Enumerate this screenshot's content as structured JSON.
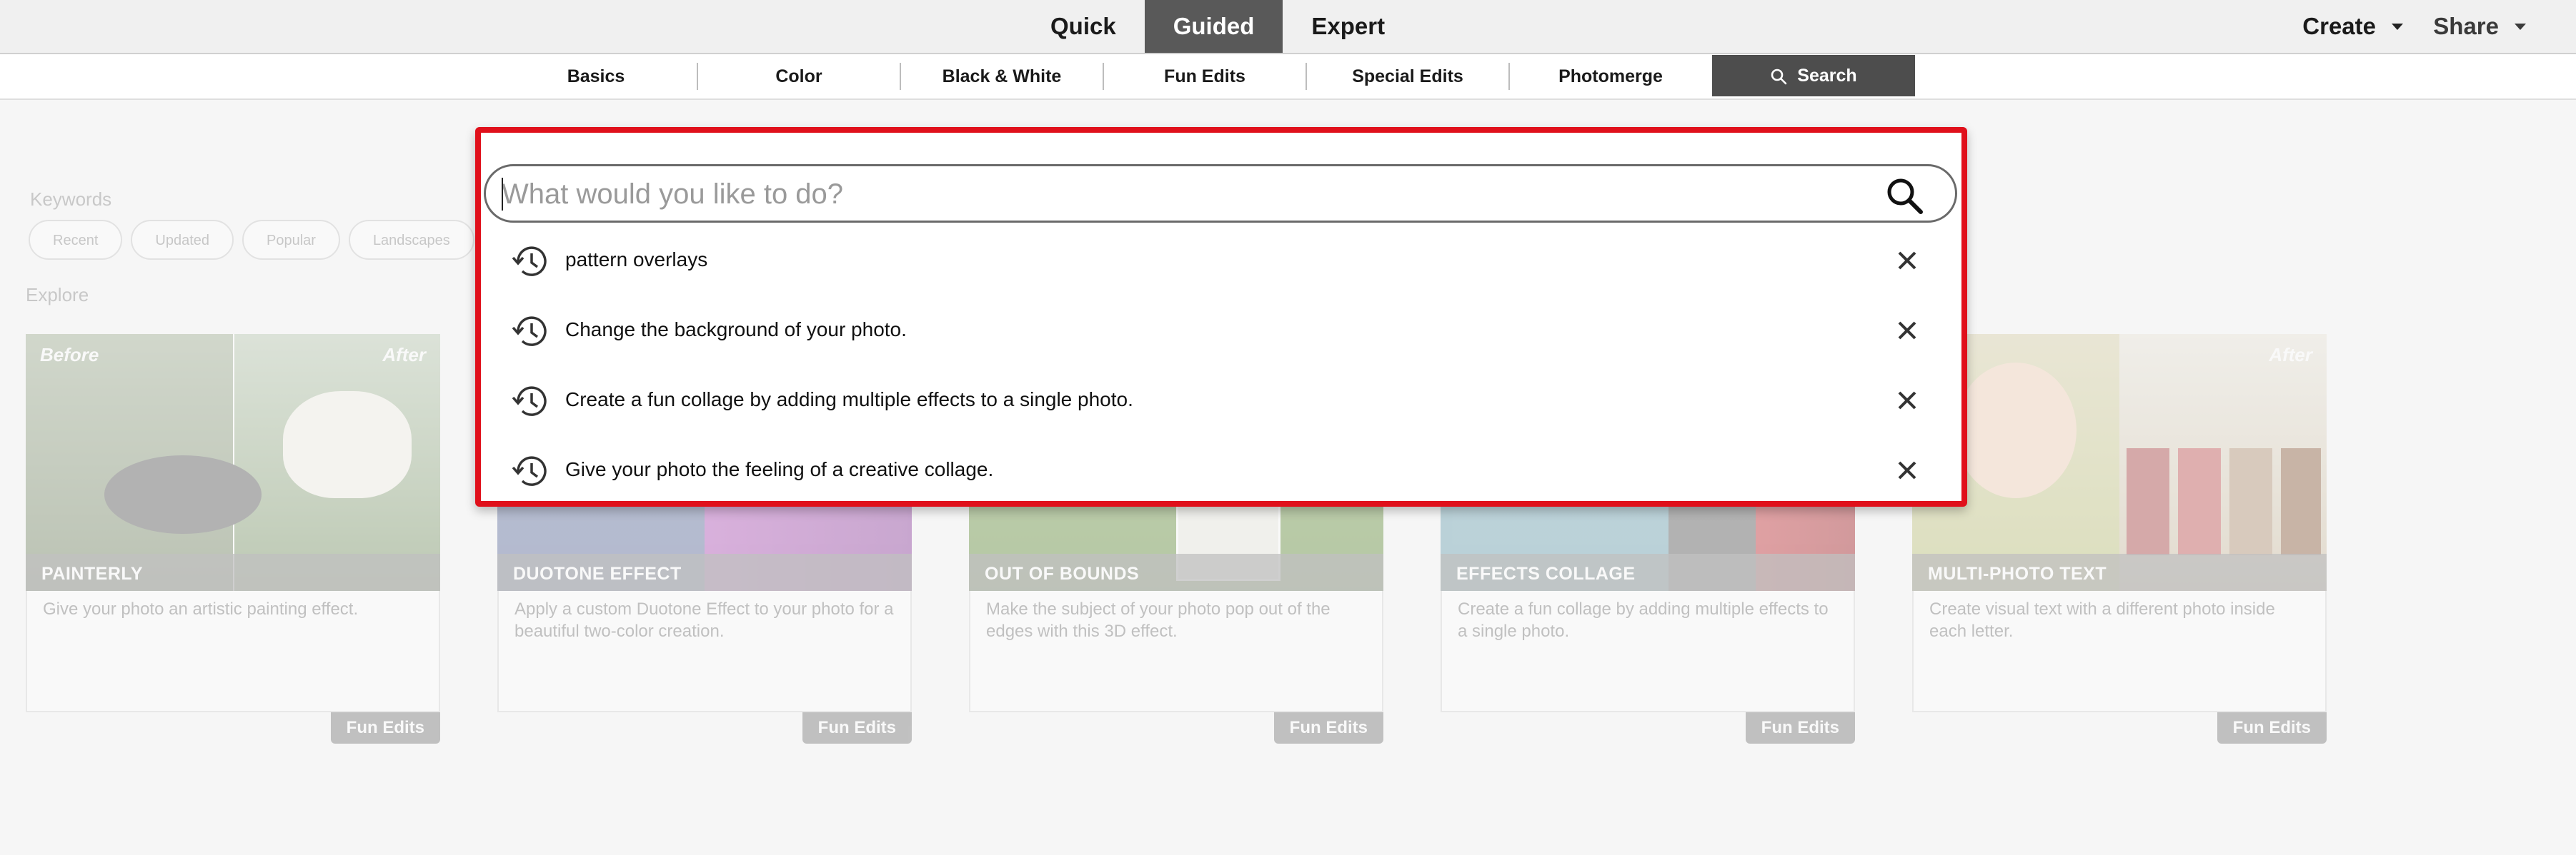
{
  "top": {
    "mode_tabs": [
      "Quick",
      "Guided",
      "Expert"
    ],
    "create_label": "Create",
    "share_label": "Share"
  },
  "categories": [
    "Basics",
    "Color",
    "Black & White",
    "Fun Edits",
    "Special Edits",
    "Photomerge"
  ],
  "search_tab_label": "Search",
  "keywords": {
    "label": "Keywords",
    "chips": [
      "Recent",
      "Updated",
      "Popular",
      "Landscapes"
    ]
  },
  "explore_label": "Explore",
  "before_label": "Before",
  "after_label": "After",
  "cards": [
    {
      "title": "PAINTERLY",
      "desc": "Give your photo an artistic painting effect.",
      "tag": "Fun Edits"
    },
    {
      "title": "DUOTONE EFFECT",
      "desc": "Apply a custom Duotone Effect to your photo for a beautiful two-color creation.",
      "tag": "Fun Edits"
    },
    {
      "title": "OUT OF BOUNDS",
      "desc": "Make the subject of your photo pop out of the edges with this 3D effect.",
      "tag": "Fun Edits"
    },
    {
      "title": "EFFECTS COLLAGE",
      "desc": "Create a fun collage by adding multiple effects to a single photo.",
      "tag": "Fun Edits"
    },
    {
      "title": "MULTI-PHOTO TEXT",
      "desc": "Create visual text with a different photo inside each letter.",
      "tag": "Fun Edits"
    }
  ],
  "search": {
    "placeholder": "What would you like to do?",
    "value": "",
    "suggestions": [
      "pattern overlays",
      "Change the background of your photo.",
      "Create a fun collage by adding multiple effects to a single photo.",
      "Give your photo the feeling of a creative collage."
    ]
  },
  "colors": {
    "highlight_border": "#e0101b",
    "active_tab": "#595959",
    "search_tab": "#4d4d4d"
  },
  "icons": {
    "search": "search-icon",
    "history": "history-icon",
    "remove": "close-icon",
    "dropdown": "chevron-down-icon"
  }
}
